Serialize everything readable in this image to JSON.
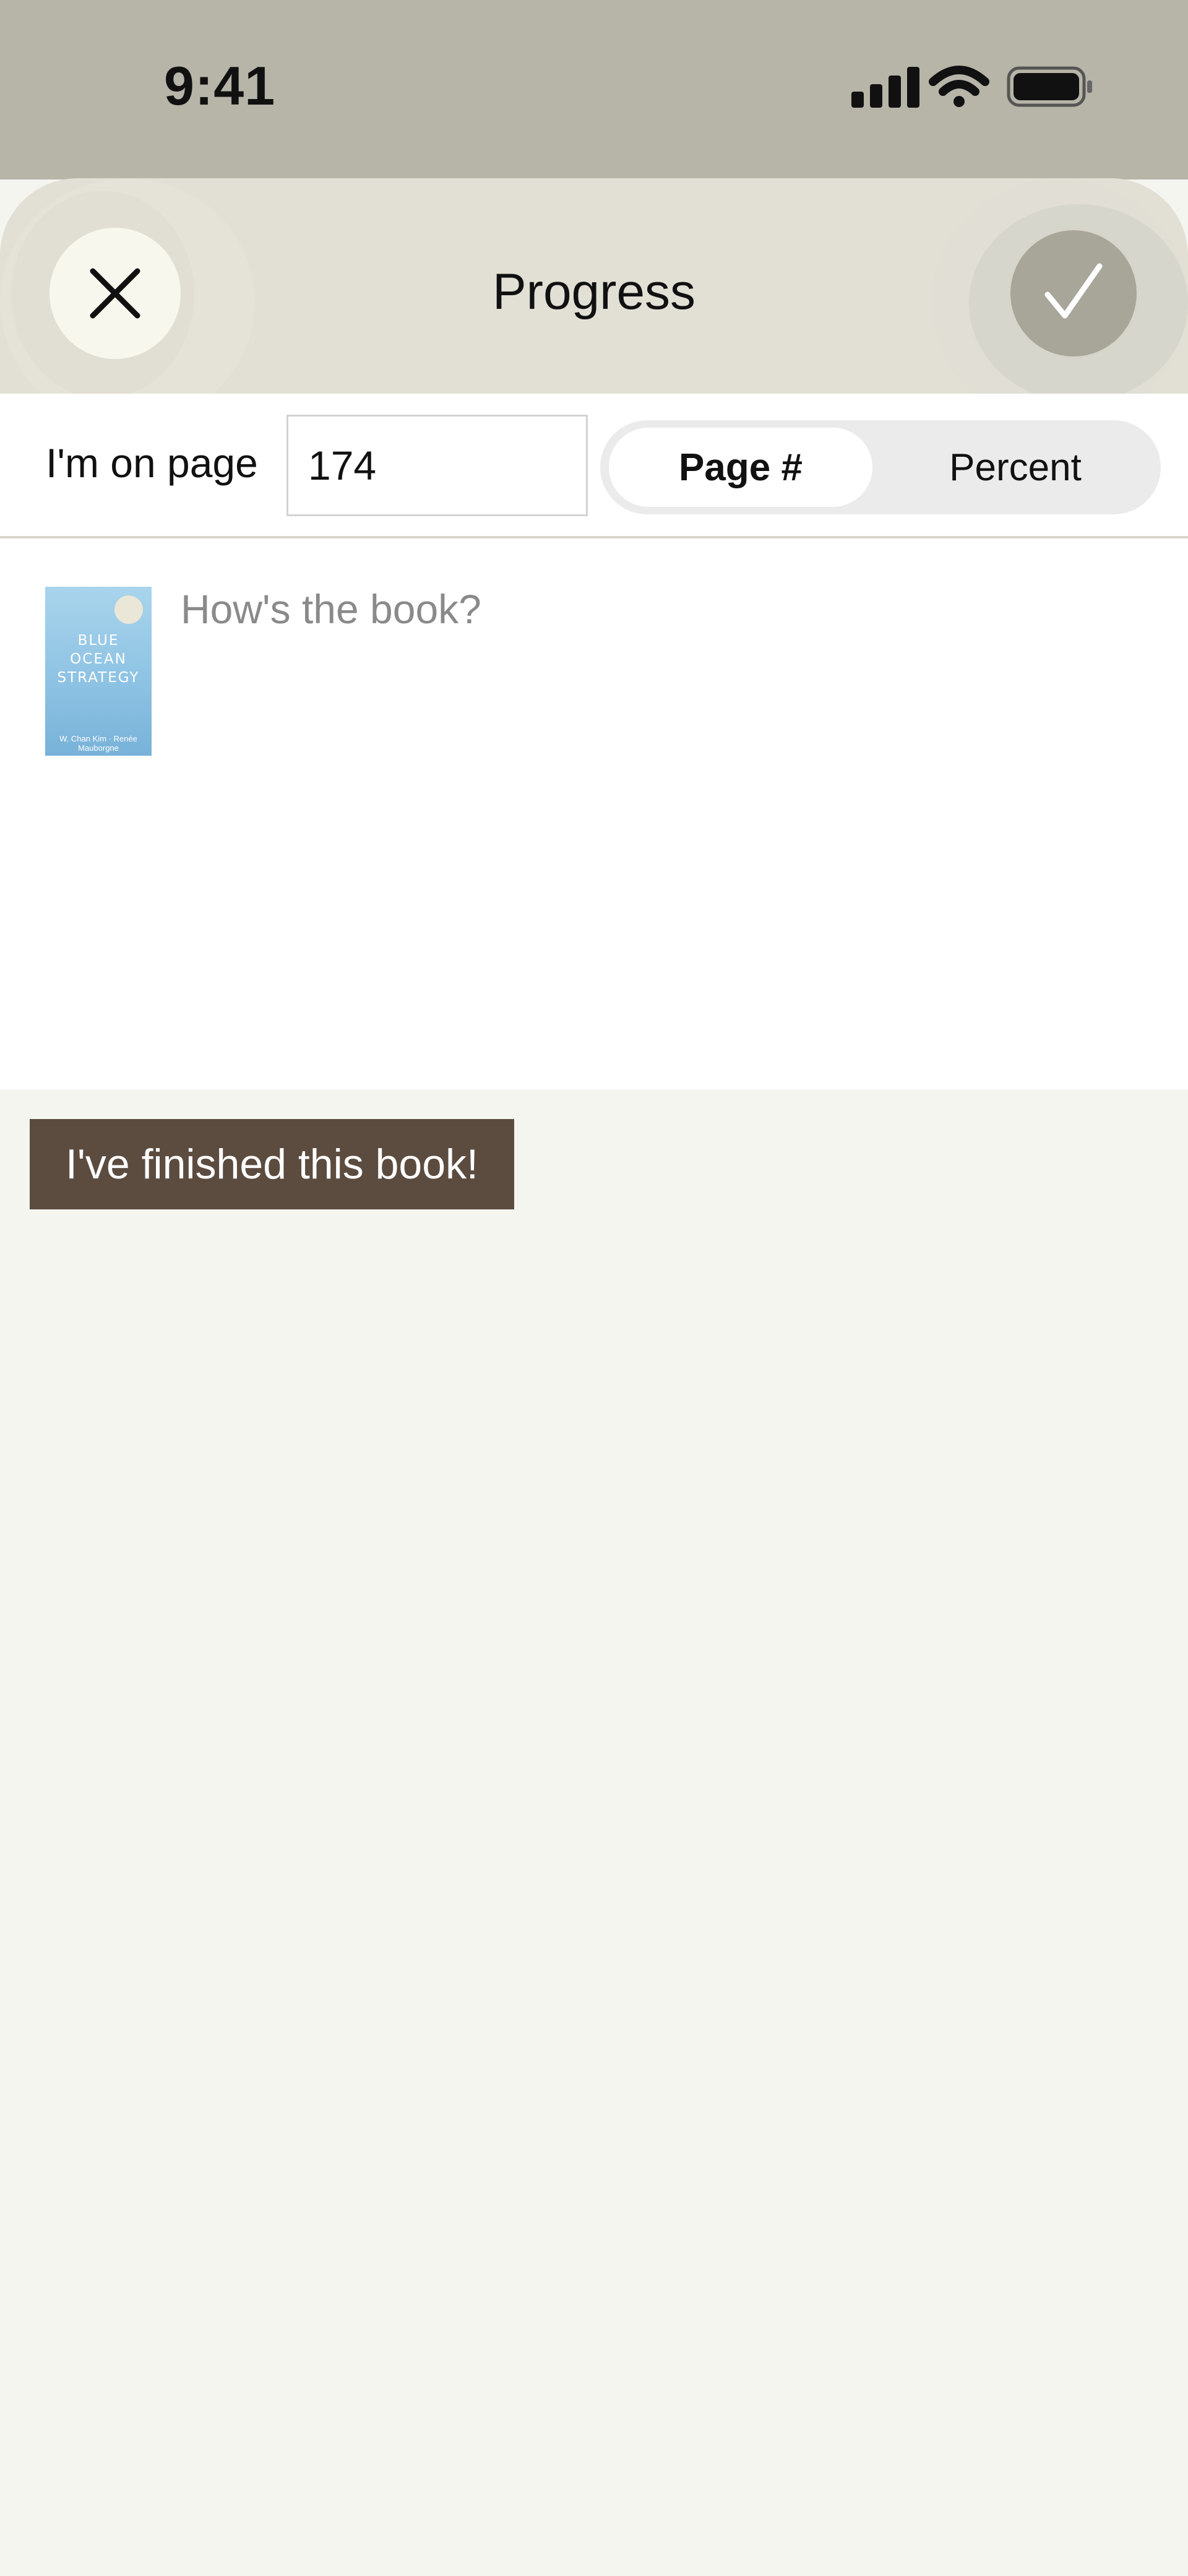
{
  "status_bar": {
    "time": "9:41",
    "icons": [
      "signal-icon",
      "wifi-icon",
      "battery-icon"
    ]
  },
  "header": {
    "title": "Progress",
    "close_icon": "close-icon",
    "confirm_icon": "checkmark-icon"
  },
  "progress_input": {
    "label": "I'm on page",
    "value": "174",
    "modes": [
      {
        "label": "Page #",
        "selected": true
      },
      {
        "label": "Percent",
        "selected": false
      }
    ]
  },
  "review": {
    "placeholder": "How's the book?",
    "book_cover": {
      "title_lines": [
        "BLUE",
        "OCEAN",
        "STRATEGY"
      ],
      "authors": "W. Chan Kim · Renée Mauborgne"
    }
  },
  "finish_button": {
    "label": "I've finished this book!"
  },
  "colors": {
    "status_bar_bg": "#b7b4a8",
    "header_bg": "#e2e0d5",
    "page_bg": "#f5f5f0",
    "finish_button_bg": "#5c4c40"
  }
}
